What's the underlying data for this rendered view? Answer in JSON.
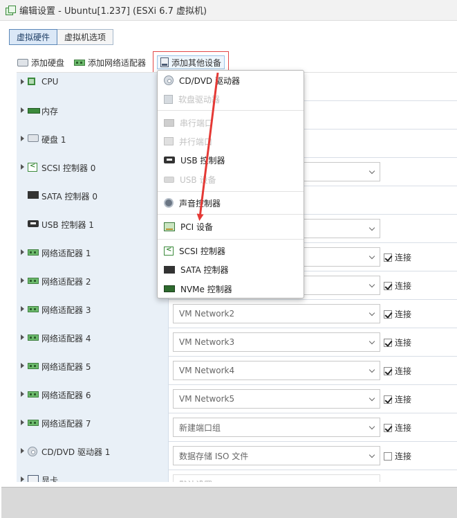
{
  "window": {
    "title": "编辑设置 - Ubuntu[1.237] (ESXi 6.7 虚拟机)"
  },
  "tabs": [
    {
      "label": "虚拟硬件",
      "active": true
    },
    {
      "label": "虚拟机选项",
      "active": false
    }
  ],
  "toolbar": {
    "add_disk": "添加硬盘",
    "add_network": "添加网络适配器",
    "add_other": "添加其他设备"
  },
  "hardware": [
    {
      "name": "CPU",
      "icon": "cpu-icon",
      "expandable": true
    },
    {
      "name": "内存",
      "icon": "memory-icon",
      "expandable": true
    },
    {
      "name": "硬盘 1",
      "icon": "hard-disk-icon",
      "expandable": true
    },
    {
      "name": "SCSI 控制器 0",
      "icon": "scsi-controller-icon",
      "expandable": true
    },
    {
      "name": "SATA 控制器 0",
      "icon": "sata-controller-icon",
      "expandable": false
    },
    {
      "name": "USB 控制器 1",
      "icon": "usb-controller-icon",
      "expandable": false
    },
    {
      "name": "网络适配器 1",
      "icon": "network-adapter-icon",
      "expandable": true,
      "connect_label": "连接",
      "connected": true
    },
    {
      "name": "网络适配器 2",
      "icon": "network-adapter-icon",
      "expandable": true,
      "connect_label": "连接",
      "connected": true
    },
    {
      "name": "网络适配器 3",
      "icon": "network-adapter-icon",
      "expandable": true,
      "value": "VM Network2",
      "connect_label": "连接",
      "connected": true
    },
    {
      "name": "网络适配器 4",
      "icon": "network-adapter-icon",
      "expandable": true,
      "value": "VM Network3",
      "connect_label": "连接",
      "connected": true
    },
    {
      "name": "网络适配器 5",
      "icon": "network-adapter-icon",
      "expandable": true,
      "value": "VM Network4",
      "connect_label": "连接",
      "connected": true
    },
    {
      "name": "网络适配器 6",
      "icon": "network-adapter-icon",
      "expandable": true,
      "value": "VM Network5",
      "connect_label": "连接",
      "connected": true
    },
    {
      "name": "网络适配器 7",
      "icon": "network-adapter-icon",
      "expandable": true,
      "value": "新建端口组",
      "connect_label": "连接",
      "connected": true
    },
    {
      "name": "CD/DVD 驱动器 1",
      "icon": "cd-dvd-icon",
      "expandable": true,
      "value": "数据存储 ISO 文件",
      "connect_label": "连接",
      "connected": false
    },
    {
      "name": "显卡",
      "icon": "video-card-icon",
      "expandable": true,
      "value": "默认设置"
    }
  ],
  "menu": {
    "items": [
      {
        "label": "CD/DVD 驱动器",
        "icon": "cd-dvd-icon",
        "enabled": true
      },
      {
        "label": "软盘驱动器",
        "icon": "floppy-icon",
        "enabled": false
      },
      {
        "label": "串行端口",
        "icon": "serial-port-icon",
        "enabled": false
      },
      {
        "label": "并行端口",
        "icon": "parallel-port-icon",
        "enabled": false
      },
      {
        "label": "USB 控制器",
        "icon": "usb-controller-icon",
        "enabled": true
      },
      {
        "label": "USB 设备",
        "icon": "usb-device-icon",
        "enabled": false
      },
      {
        "label": "声音控制器",
        "icon": "sound-controller-icon",
        "enabled": true
      },
      {
        "label": "PCI 设备",
        "icon": "pci-device-icon",
        "enabled": true
      },
      {
        "label": "SCSI 控制器",
        "icon": "scsi-controller-icon",
        "enabled": true
      },
      {
        "label": "SATA 控制器",
        "icon": "sata-controller-icon",
        "enabled": true
      },
      {
        "label": "NVMe 控制器",
        "icon": "nvme-controller-icon",
        "enabled": true
      }
    ]
  },
  "colors": {
    "accent_border": "#e14646",
    "arrow": "#e53935",
    "tab_active_bg": "#dbe8f7",
    "row_label_bg": "#e9f0f7"
  }
}
